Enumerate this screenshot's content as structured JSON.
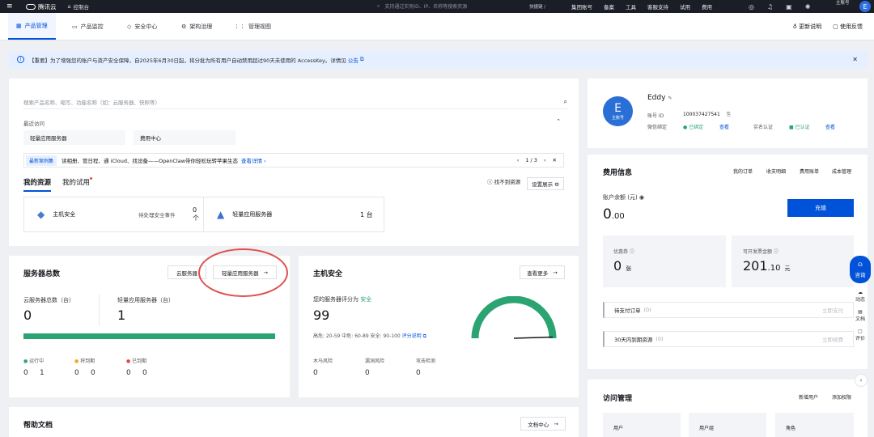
{
  "topbar": {
    "brand": "腾讯云",
    "console": "控制台",
    "search_placeholder": "支持通过实例ID、IP、名称等搜索资源",
    "shortcut": "快捷键 /",
    "nav": [
      "集团账号",
      "备案",
      "工具",
      "客服支持",
      "试用",
      "费用"
    ],
    "account_label": "主账号",
    "avatar_letter": "E"
  },
  "tabs": [
    {
      "label": "产品管理",
      "active": true
    },
    {
      "label": "产品监控",
      "active": false
    },
    {
      "label": "安全中心",
      "active": false
    },
    {
      "label": "架构治理",
      "active": false
    },
    {
      "label": "管理视图",
      "active": false
    }
  ],
  "tab_right": {
    "update_notes": "更新说明",
    "feedback": "使用反馈"
  },
  "notice": {
    "text": "【重要】为了增强您的账户与资产安全保障，自2025年6月30日起，将分批为所有用户自动禁用超过90天未使用的 AccessKey。详情见",
    "link": "公告"
  },
  "products": {
    "search_placeholder": "搜索产品名称、缩写、功能名称（如：云服务器、快照等）",
    "recent_label": "最近访问",
    "recent_items": [
      "轻量应用服务器",
      "费用中心"
    ],
    "promo_tag": "最新案例集",
    "promo_text": "读相册、管日程、通 iCloud、找设备——OpenClaw带你轻松玩转苹果生态",
    "promo_link": "查看详情",
    "promo_page": "1 / 3",
    "res_tabs": [
      "我的资源",
      "我的试用"
    ],
    "cant_find": "找不到资源",
    "display_settings": "设置展示",
    "res_host_security": "主机安全",
    "res_pending_label": "待处理安全事件",
    "res_pending_value": "0 个",
    "res_lighthouse": "轻量应用服务器",
    "res_lighthouse_value": "1 台"
  },
  "servers": {
    "title": "服务器总数",
    "btn_cvm": "云服务器",
    "btn_lighthouse": "轻量应用服务器",
    "cvm_label": "云服务器总数（台）",
    "cvm_value": "0",
    "lh_label": "轻量应用服务器（台）",
    "lh_value": "1",
    "status": [
      {
        "label": "运行中",
        "color": "#2ba471"
      },
      {
        "label": "将到期",
        "color": "#f5a623"
      },
      {
        "label": "已到期",
        "color": "#e54545"
      }
    ],
    "counts": [
      "0",
      "1",
      "0",
      "0",
      "0",
      "0"
    ]
  },
  "host_security": {
    "title": "主机安全",
    "view_more": "查看更多",
    "score_label": "您的服务器评分为",
    "score_status": "安全",
    "score": "99",
    "range_text": "高危: 20-59  中危: 60-89  安全: 90-100",
    "range_link": "评分说明",
    "gauge_fraction": 0.99,
    "items": [
      {
        "label": "木马风险",
        "value": "0"
      },
      {
        "label": "漏洞风险",
        "value": "0"
      },
      {
        "label": "攻击检测",
        "value": "0"
      }
    ]
  },
  "docs": {
    "title": "帮助文档",
    "center": "文档中心"
  },
  "account": {
    "avatar_letter": "E",
    "avatar_tag": "主账号",
    "name": "Eddy",
    "id_label": "账号 ID",
    "id_value": "100037427541",
    "wechat_label": "微信绑定",
    "wechat_status": "已绑定",
    "view": "查看",
    "realname_label": "实名认证",
    "realname_status": "已认证"
  },
  "billing": {
    "title": "费用信息",
    "links": [
      "我的订单",
      "收支明细",
      "费用账单",
      "成本管理"
    ],
    "balance_label": "账户余额 (元)",
    "balance_int": "0",
    "balance_dec": ".00",
    "recharge": "充值",
    "coupon_label": "优惠券",
    "coupon_value": "0",
    "coupon_unit": "张",
    "invoice_label": "可开发票金额",
    "invoice_int": "201",
    "invoice_dec": ".10",
    "invoice_unit": "元",
    "pending_label": "待支付订单",
    "pending_count": "(0)",
    "pending_action": "立即支付",
    "expiring_label": "30天内到期资源",
    "expiring_count": "(0)",
    "expiring_action": "立即续费"
  },
  "access": {
    "title": "访问管理",
    "new_user": "新增用户",
    "add_permission": "添加权限",
    "cols": [
      "用户",
      "用户组",
      "角色"
    ]
  },
  "float": {
    "consult": "咨询",
    "dynamic": "动态",
    "docs": "文档",
    "review": "评价"
  },
  "colors": {
    "accent": "#0052d9",
    "success": "#2ba471",
    "annotation": "#e05050"
  }
}
